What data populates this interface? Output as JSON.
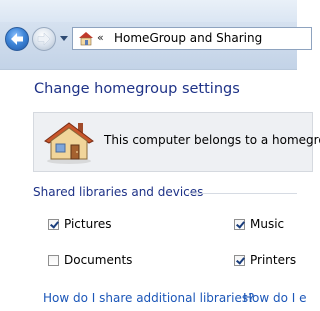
{
  "navigation": {
    "back_icon": "back-arrow-icon",
    "forward_icon": "forward-arrow-icon",
    "recent_icon": "chevron-down-icon"
  },
  "address_bar": {
    "location_icon": "homegroup-icon",
    "chevron": "«",
    "breadcrumb": "HomeGroup and Sharing"
  },
  "main": {
    "title": "Change homegroup settings",
    "info_text": "This computer belongs to a homegro",
    "info_icon": "homegroup-house-icon",
    "section_label": "Shared libraries and devices",
    "libraries": [
      {
        "label": "Pictures",
        "checked": true
      },
      {
        "label": "Music",
        "checked": true
      },
      {
        "label": "Documents",
        "checked": false
      },
      {
        "label": "Printers",
        "checked": true
      }
    ],
    "links": {
      "share_additional": "How do I share additional libraries?",
      "second": "How do I e"
    }
  },
  "colors": {
    "title_blue": "#1e3287",
    "link_blue": "#1b56b8",
    "nav_gradient_top": "#dfe9f5",
    "nav_gradient_bottom": "#c3d3e7"
  }
}
